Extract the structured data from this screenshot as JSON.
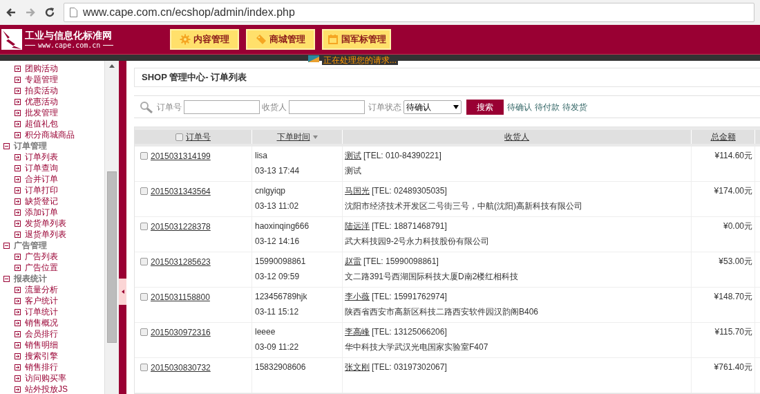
{
  "browser": {
    "url": "www.cape.com.cn/ecshop/admin/index.php"
  },
  "header": {
    "site_name": "工业与信息化标准网",
    "site_url": "www.cape.com.cn",
    "nav": [
      {
        "label": "内容管理"
      },
      {
        "label": "商城管理"
      },
      {
        "label": "国军标管理"
      }
    ],
    "loading": "正在处理您的请求..."
  },
  "sidebar": {
    "sections": [
      {
        "items": [
          "团购活动",
          "专题管理",
          "拍卖活动",
          "优惠活动",
          "批发管理",
          "超值礼包",
          "积分商城商品"
        ]
      },
      {
        "title": "订单管理",
        "expanded": true,
        "items": [
          "订单列表",
          "订单查询",
          "合并订单",
          "订单打印",
          "缺货登记",
          "添加订单",
          "发货单列表",
          "退货单列表"
        ]
      },
      {
        "title": "广告管理",
        "expanded": true,
        "items": [
          "广告列表",
          "广告位置"
        ]
      },
      {
        "title": "报表统计",
        "expanded": true,
        "items": [
          "流量分析",
          "客户统计",
          "订单统计",
          "销售概况",
          "会员排行",
          "销售明细",
          "搜索引擎",
          "销售排行",
          "访问购买率",
          "站外投放JS"
        ]
      }
    ]
  },
  "page_title": "SHOP 管理中心- 订单列表",
  "search": {
    "order_no_label": "订单号",
    "consignee_label": "收货人",
    "status_label": "订单状态",
    "status_value": "待确认",
    "button": "搜索",
    "quick_links": [
      "待确认",
      "待付款",
      "待发货"
    ]
  },
  "table": {
    "all_checked": false,
    "columns": [
      "订单号",
      "下单时间",
      "收货人",
      "总金额"
    ],
    "rows": [
      {
        "order_no": "2015031314199",
        "checked": false,
        "user": "lisa",
        "time": "03-13 17:44",
        "name": "测试",
        "tel": "[TEL: 010-84390221]",
        "address": "测试",
        "total": "¥114.60元"
      },
      {
        "order_no": "2015031343564",
        "checked": false,
        "user": "cnlgyiqp",
        "time": "03-13 11:02",
        "name": "马国光",
        "tel": "[TEL: 02489305035]",
        "address": "沈阳市经济技术开发区二号街三号，中航(沈阳)高新科技有限公司",
        "total": "¥174.00元"
      },
      {
        "order_no": "2015031228378",
        "checked": false,
        "user": "haoxinqing666",
        "time": "03-12 14:16",
        "name": "陆远洋",
        "tel": "[TEL: 18871468791]",
        "address": "武大科技园9-2号永力科技股份有限公司",
        "total": "¥0.00元"
      },
      {
        "order_no": "2015031285623",
        "checked": false,
        "user": "15990098861",
        "time": "03-12 09:59",
        "name": "赵雷",
        "tel": "[TEL: 15990098861]",
        "address": "文二路391号西湖国际科技大厦D南2楼红相科技",
        "total": "¥53.00元"
      },
      {
        "order_no": "2015031158800",
        "checked": false,
        "user": "123456789hjk",
        "time": "03-11 15:12",
        "name": "李小薇",
        "tel": "[TEL: 15991762974]",
        "address": "陕西省西安市高新区科技二路西安软件园汉韵阁B406",
        "total": "¥148.70元"
      },
      {
        "order_no": "2015030972316",
        "checked": false,
        "user": "leeee",
        "time": "03-09 11:22",
        "name": "李高峰",
        "tel": "[TEL: 13125066206]",
        "address": "华中科技大学武汉光电国家实验室F407",
        "total": "¥115.70元"
      },
      {
        "order_no": "2015030830732",
        "checked": false,
        "user": "15832908606",
        "name": "张文刚",
        "tel": "[TEL: 03197302067]",
        "total": "¥761.40元"
      }
    ]
  }
}
